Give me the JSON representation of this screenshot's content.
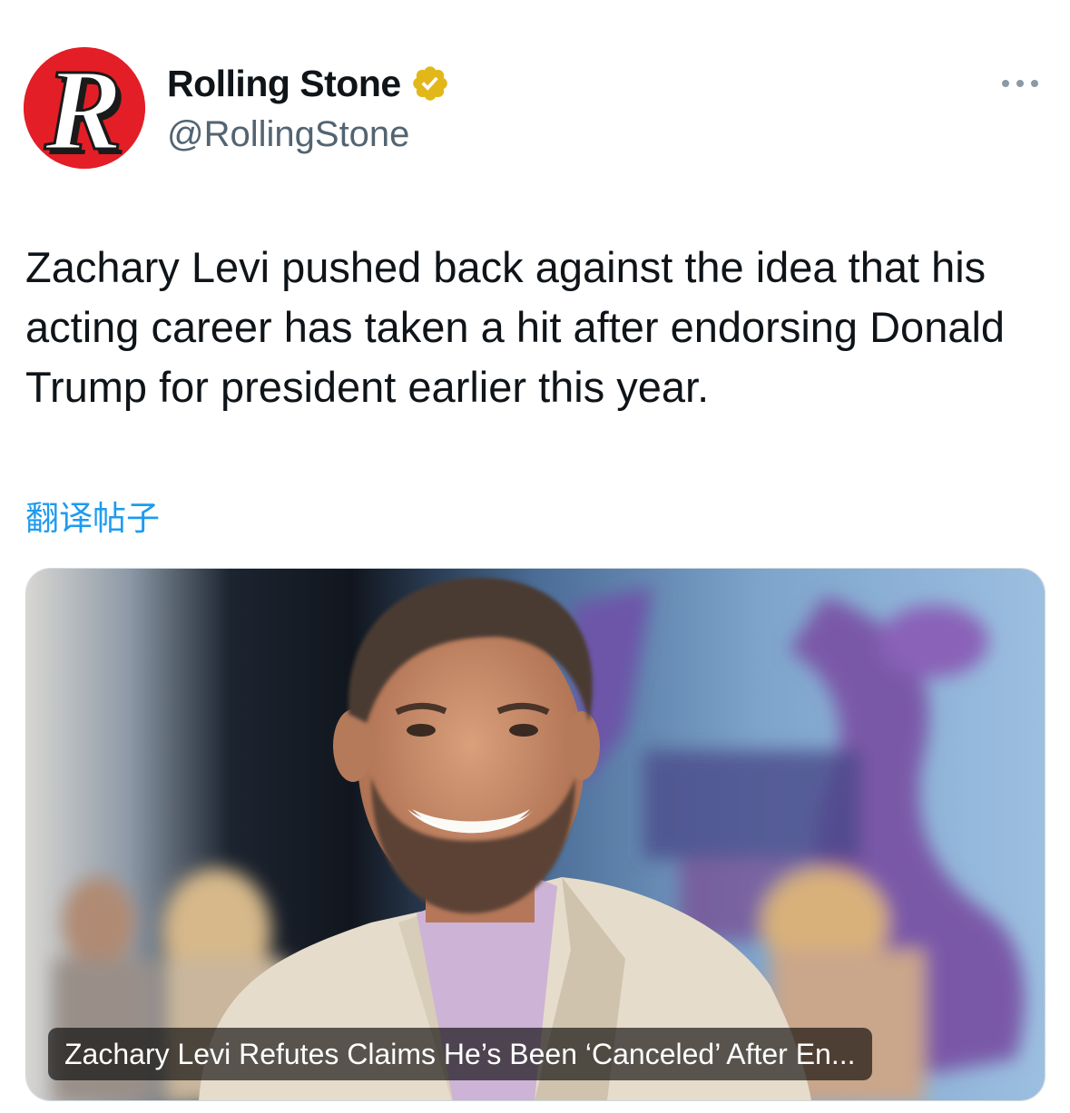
{
  "account": {
    "display_name": "Rolling Stone",
    "handle": "@RollingStone",
    "verified": true,
    "avatar_letter": "R",
    "avatar_color": "#e31e26",
    "badge_color": "#e2b719"
  },
  "tweet": {
    "text": "Zachary Levi pushed back against the idea that his acting career has taken a hit after endorsing Donald Trump for president earlier this year.",
    "translate_label": "翻译帖子"
  },
  "link_card": {
    "title": "Zachary Levi Refutes Claims He’s Been ‘Canceled’ After En..."
  },
  "icons": {
    "more": "more-horizontal-icon",
    "verified": "verified-badge-icon"
  },
  "colors": {
    "link": "#1d9bf0",
    "secondary_text": "#536471"
  }
}
